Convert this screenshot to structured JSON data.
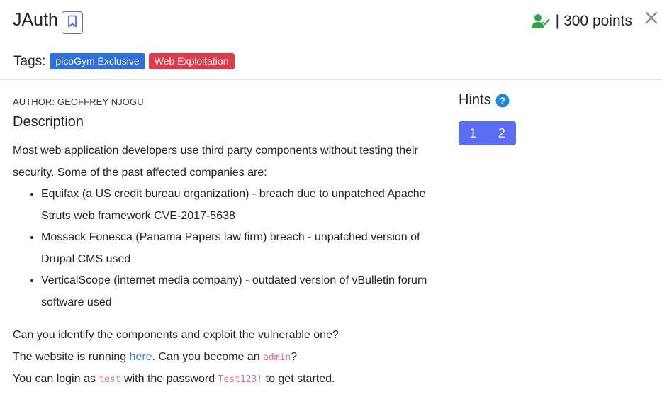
{
  "challenge": {
    "title": "JAuth",
    "points_text": "300 points",
    "separator": "|"
  },
  "tags": {
    "label": "Tags:",
    "items": [
      {
        "label": "picoGym Exclusive",
        "color": "#2f6fdc"
      },
      {
        "label": "Web Exploitation",
        "color": "#e2394a"
      }
    ]
  },
  "author": "AUTHOR: GEOFFREY NJOGU",
  "description": {
    "heading": "Description",
    "intro": "Most web application developers use third party components without testing their security. Some of the past affected companies are:",
    "bullets": [
      "Equifax (a US credit bureau organization) - breach due to unpatched Apache Struts web framework CVE-2017-5638",
      "Mossack Fonesca (Panama Papers law firm) breach - unpatched version of Drupal CMS used",
      "VerticalScope (internet media company) - outdated version of vBulletin forum software used"
    ],
    "line1": "Can you identify the components and exploit the vulnerable one?",
    "line2_a": "The website is running ",
    "line2_link": "here",
    "line2_b": ". Can you become an ",
    "line2_code": "admin",
    "line2_c": "?",
    "line3_a": "You can login as ",
    "line3_code1": "test",
    "line3_b": " with the password ",
    "line3_code2": "Test123!",
    "line3_c": " to get started."
  },
  "hints": {
    "title": "Hints",
    "buttons": [
      "1",
      "2"
    ]
  },
  "colors": {
    "solved_green": "#28a745",
    "hint_blue": "#5b6cf5",
    "help_blue": "#1e88e5",
    "code_pink": "#e8679a",
    "link_blue": "#3b82f6"
  },
  "icons": [
    "bookmark-icon",
    "user-check-icon",
    "close-icon",
    "help-circle-icon"
  ]
}
